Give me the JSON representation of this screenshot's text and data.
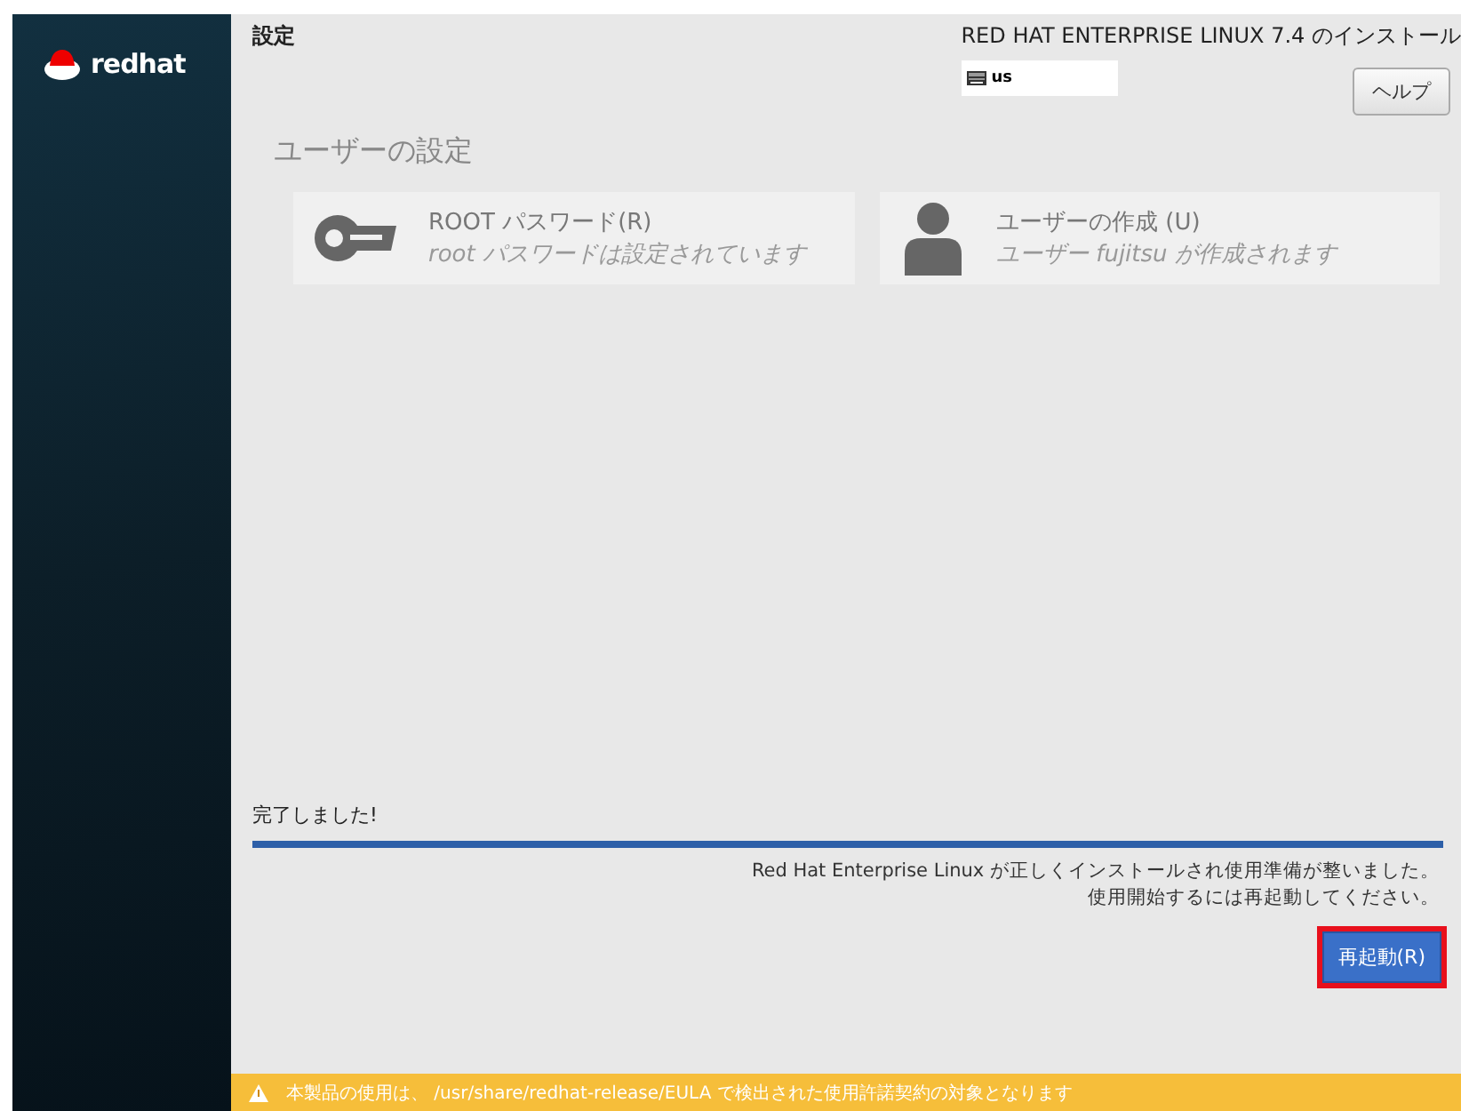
{
  "sidebar": {
    "logo_text": "redhat"
  },
  "header": {
    "title": "設定",
    "product": "RED HAT ENTERPRISE LINUX 7.4 のインストール",
    "keyboard": "us",
    "help_button": "ヘルプ"
  },
  "section": {
    "title": "ユーザーの設定",
    "spokes": [
      {
        "kind": "key",
        "title": "ROOT パスワード(R)",
        "status": "root パスワードは設定されています"
      },
      {
        "kind": "user",
        "title": "ユーザーの作成 (U)",
        "status": "ユーザー fujitsu が作成されます"
      }
    ]
  },
  "progress": {
    "label": "完了しました!",
    "level": 1,
    "message_lines": [
      "Red Hat Enterprise Linux が正しくインストールされ使用準備が整いました。",
      "使用開始するには再起動してください。"
    ]
  },
  "reboot_button": {
    "label": "再起動(R)",
    "highlighted": true
  },
  "warning_bar": {
    "text": "本製品の使用は、 /usr/share/redhat-release/EULA で検出された使用許諾契約の対象となります"
  }
}
